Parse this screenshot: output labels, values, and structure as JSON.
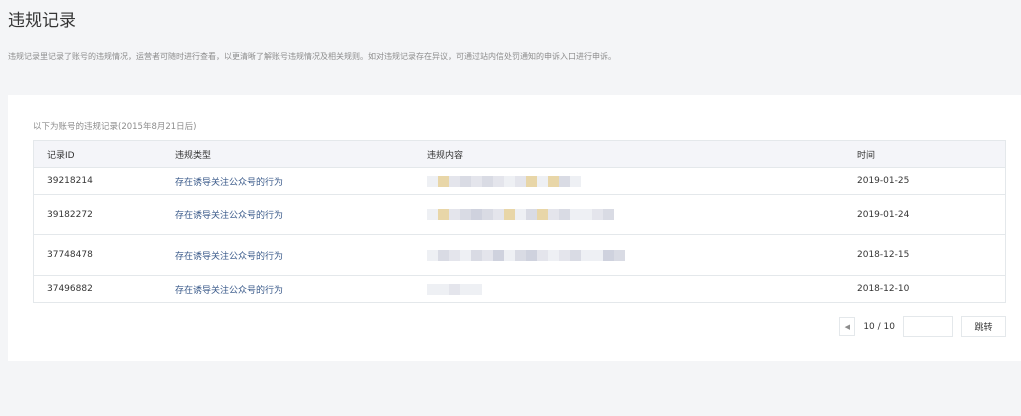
{
  "page": {
    "title": "违规记录",
    "description": "违规记录里记录了账号的违规情况，运营者可随时进行查看，以更清晰了解账号违规情况及相关规则。如对违规记录存在异议，可通过站内信处罚通知的申诉入口进行申诉。"
  },
  "table": {
    "caption": "以下为账号的违规记录(2015年8月21日后)",
    "headers": {
      "id": "记录ID",
      "type": "违规类型",
      "content": "违规内容",
      "time": "时间"
    },
    "rows": [
      {
        "id": "39218214",
        "type": "存在诱导关注公众号的行为",
        "time": "2019-01-25"
      },
      {
        "id": "39182272",
        "type": "存在诱导关注公众号的行为",
        "time": "2019-01-24"
      },
      {
        "id": "37748478",
        "type": "存在诱导关注公众号的行为",
        "time": "2018-12-15"
      },
      {
        "id": "37496882",
        "type": "存在诱导关注公众号的行为",
        "time": "2018-12-10"
      }
    ]
  },
  "pagination": {
    "info": "10 / 10",
    "jump_input_value": "",
    "jump_label": "跳转",
    "prev_icon": "caret-left-icon"
  },
  "colors": {
    "link": "#3a5a8a",
    "page_bg": "#f4f5f7",
    "header_bg": "#f4f5f9",
    "border": "#e4e8eb"
  }
}
